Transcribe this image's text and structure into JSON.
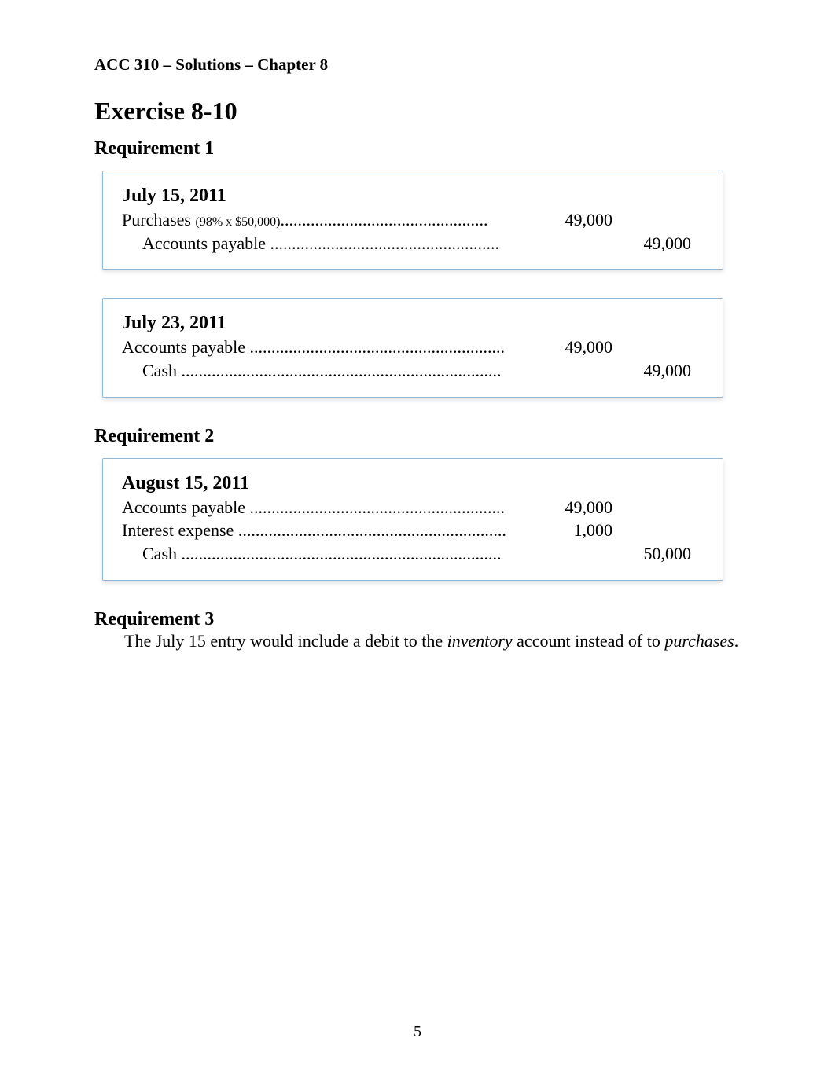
{
  "header": "ACC 310 – Solutions – Chapter 8",
  "exercise_title": "Exercise 8-10",
  "req1_title": "Requirement 1",
  "entry1": {
    "date": "July 15, 2011",
    "line1_label": "Purchases ",
    "line1_note": "(98% x $50,000)",
    "line1_dots": "................................................",
    "line1_debit": "49,000",
    "line2_label": "Accounts payable ",
    "line2_dots": ".....................................................",
    "line2_credit": "49,000"
  },
  "entry2": {
    "date": "July 23, 2011",
    "line1_label": "Accounts payable ",
    "line1_dots": "...........................................................",
    "line1_debit": "49,000",
    "line2_label": "Cash ",
    "line2_dots": "..........................................................................",
    "line2_credit": "49,000"
  },
  "req2_title": "Requirement 2",
  "entry3": {
    "date": "August 15, 2011",
    "line1_label": "Accounts payable ",
    "line1_dots": "...........................................................",
    "line1_debit": "49,000",
    "line2_label": "Interest expense ",
    "line2_dots": "..............................................................",
    "line2_debit": "1,000",
    "line3_label": "Cash ",
    "line3_dots": "..........................................................................",
    "line3_credit": "50,000"
  },
  "req3_title": "Requirement 3",
  "req3_text_a": "The July 15 entry would include a debit to the ",
  "req3_text_inv": "inventory",
  "req3_text_b": " account instead of to ",
  "req3_text_pur": "purchases",
  "req3_text_c": ".",
  "page_number": "5"
}
